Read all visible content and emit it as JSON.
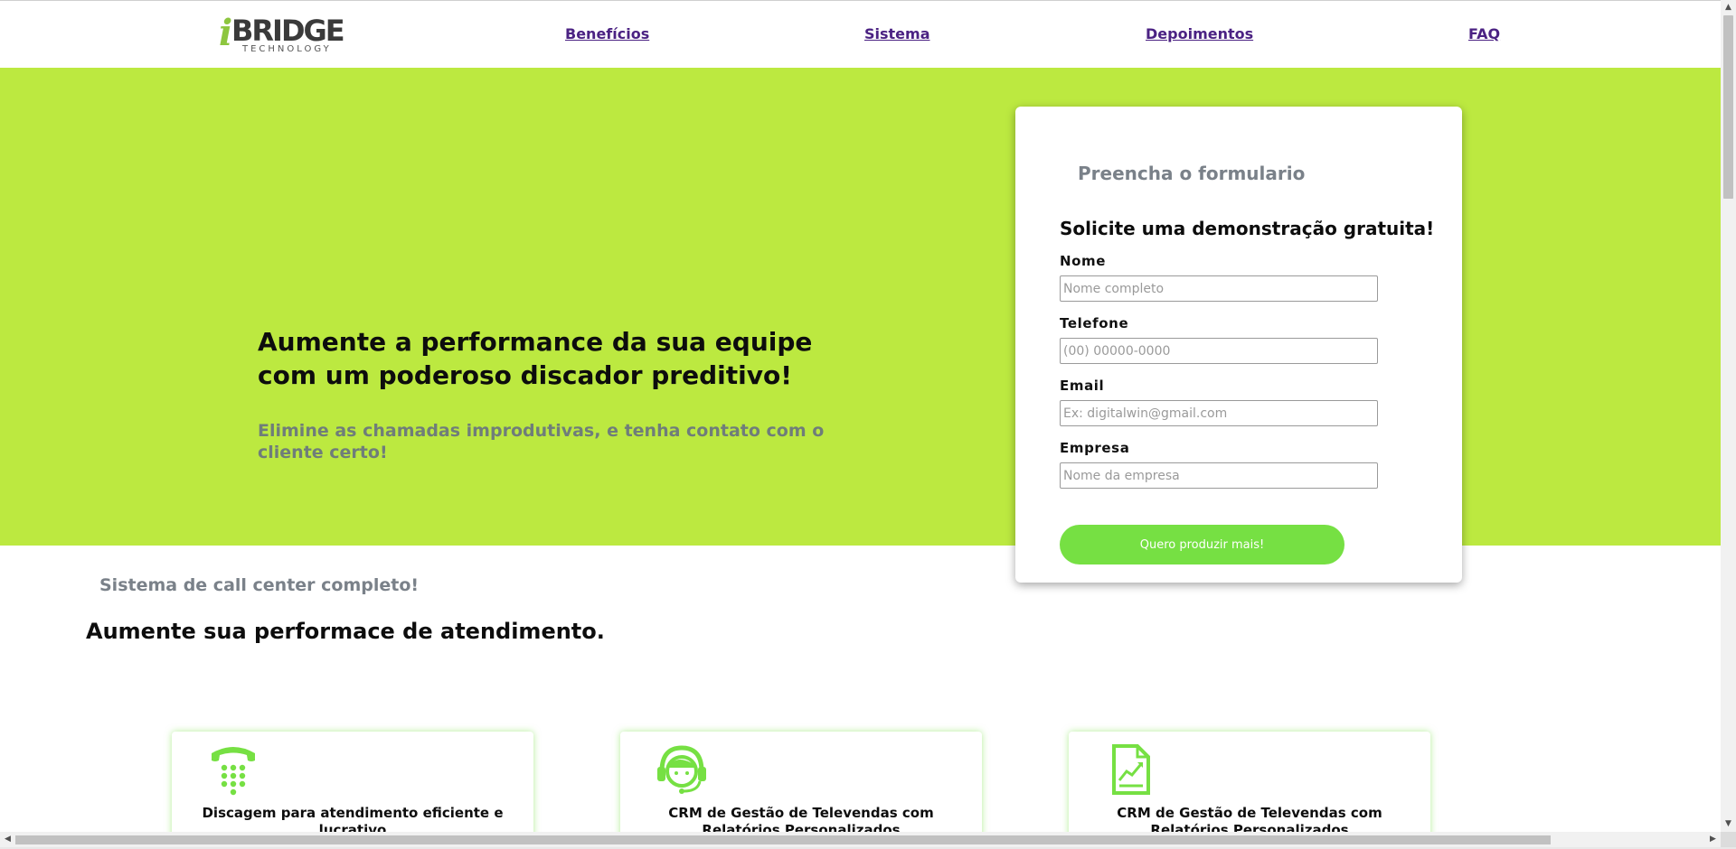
{
  "header": {
    "logo": {
      "i": "i",
      "main": "BRIDGE",
      "sub": "TECHNOLOGY"
    },
    "nav": [
      {
        "label": "Benefícios"
      },
      {
        "label": "Sistema"
      },
      {
        "label": "Depoimentos"
      },
      {
        "label": "FAQ"
      }
    ]
  },
  "hero": {
    "title": "Aumente a performance da sua equipe com um poderoso discador preditivo!",
    "subtitle": "Elimine as chamadas improdutivas, e tenha contato com o cliente certo!"
  },
  "form": {
    "kicker": "Preencha o formulario",
    "title": "Solicite uma demonstração gratuita!",
    "fields": [
      {
        "label": "Nome",
        "placeholder": "Nome completo",
        "value": ""
      },
      {
        "label": "Telefone",
        "placeholder": "(00) 00000-0000",
        "value": ""
      },
      {
        "label": "Email",
        "placeholder": "Ex: digitalwin@gmail.com",
        "value": ""
      },
      {
        "label": "Empresa",
        "placeholder": "Nome da empresa",
        "value": ""
      }
    ],
    "submit_label": "Quero produzir mais!"
  },
  "section": {
    "kicker": "Sistema de call center completo!",
    "title": "Aumente sua performace de atendimento."
  },
  "features": [
    {
      "icon": "telephone-icon",
      "title": "Discagem para atendimento eficiente e lucrativo"
    },
    {
      "icon": "headset-agent-icon",
      "title": "CRM de Gestão de Televendas com Relatórios Personalizados"
    },
    {
      "icon": "report-chart-icon",
      "title": "CRM de Gestão de Televendas com Relatórios Personalizados"
    }
  ],
  "colors": {
    "hero_bg": "#bce940",
    "accent_green": "#76e043",
    "nav_link": "#4b2283",
    "muted_text": "#7a8189"
  }
}
